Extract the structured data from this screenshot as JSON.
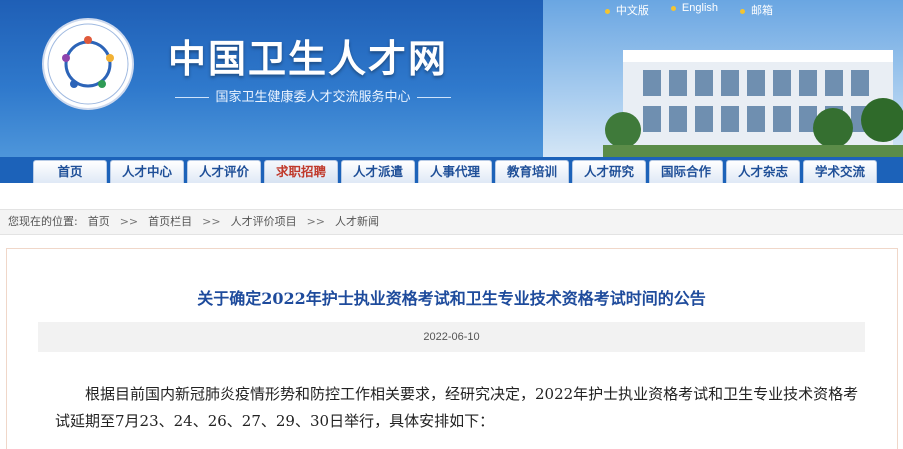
{
  "header": {
    "site_title": "中国卫生人才网",
    "site_subtitle": "国家卫生健康委人才交流服务中心",
    "top_links": [
      "中文版",
      "English",
      "邮箱"
    ],
    "logo_text": "国家卫生健康委人才交流服务中心"
  },
  "nav": {
    "items": [
      "首页",
      "人才中心",
      "人才评价",
      "求职招聘",
      "人才派遣",
      "人事代理",
      "教育培训",
      "人才研究",
      "国际合作",
      "人才杂志",
      "学术交流"
    ],
    "active_index": 3
  },
  "breadcrumb": {
    "label": "您现在的位置:",
    "items": [
      "首页",
      "首页栏目",
      "人才评价项目",
      "人才新闻"
    ],
    "separator": ">>"
  },
  "article": {
    "title": "关于确定2022年护士执业资格考试和卫生专业技术资格考试时间的公告",
    "date": "2022-06-10",
    "paragraph": "根据目前国内新冠肺炎疫情形势和防控工作相关要求，经研究决定，2022年护士执业资格考试和卫生专业技术资格考试延期至7月23、24、26、27、29、30日举行，具体安排如下："
  },
  "colors": {
    "header_blue": "#1f5fb6",
    "nav_active_text": "#c0392b",
    "title_blue": "#1e4b9c"
  }
}
